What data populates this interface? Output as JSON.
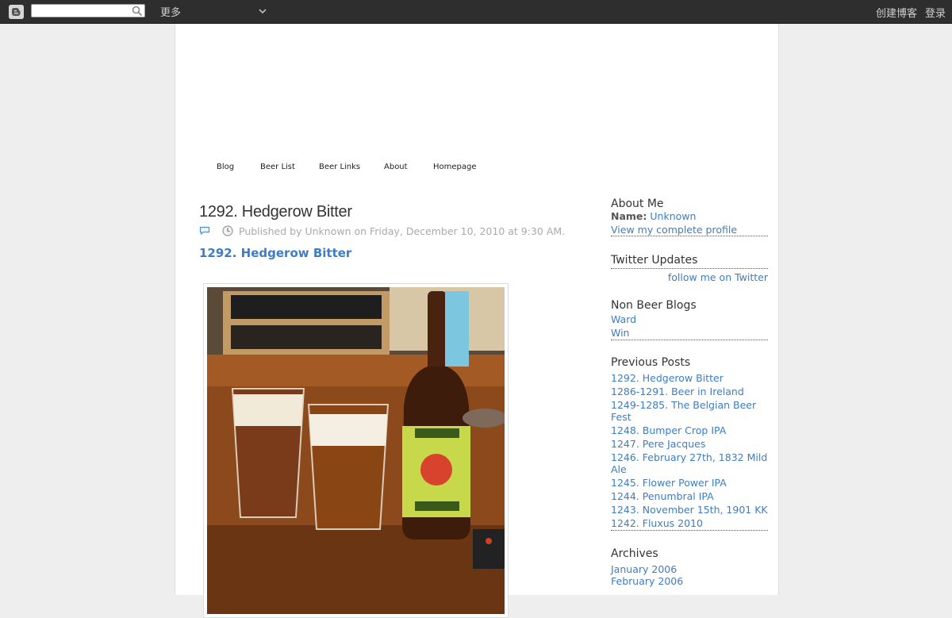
{
  "navbar": {
    "search_value": "",
    "more_label": "更多",
    "create_blog": "创建博客",
    "login": "登录"
  },
  "tabs": [
    "Blog",
    "Beer List",
    "Beer Links",
    "About",
    "Homepage"
  ],
  "post": {
    "title": "1292. Hedgerow Bitter",
    "meta": "Published by Unknown on Friday, December 10, 2010 at 9:30 AM.",
    "link_title": "1292. Hedgerow Bitter"
  },
  "sidebar": {
    "about": {
      "title": "About Me",
      "name_label": "Name:",
      "name_value": "Unknown",
      "profile_link": "View my complete profile"
    },
    "twitter": {
      "title": "Twitter Updates",
      "follow": "follow me on Twitter"
    },
    "non_beer": {
      "title": "Non Beer Blogs",
      "links": [
        "Ward",
        "Win"
      ]
    },
    "previous": {
      "title": "Previous Posts",
      "links": [
        "1292. Hedgerow Bitter",
        "1286-1291. Beer in Ireland",
        "1249-1285. The Belgian Beer Fest",
        "1248. Bumper Crop IPA",
        "1247. Pere Jacques",
        "1246. February 27th, 1832 Mild Ale",
        "1245. Flower Power IPA",
        "1244. Penumbral IPA",
        "1243. November 15th, 1901 KK",
        "1242. Fluxus 2010"
      ]
    },
    "archives": {
      "title": "Archives",
      "links": [
        "January 2006",
        "February 2006"
      ]
    }
  },
  "colors": {
    "navbar": "#2e2e2e",
    "link": "#3c7dc4",
    "page_bg": "#eeeeee"
  }
}
